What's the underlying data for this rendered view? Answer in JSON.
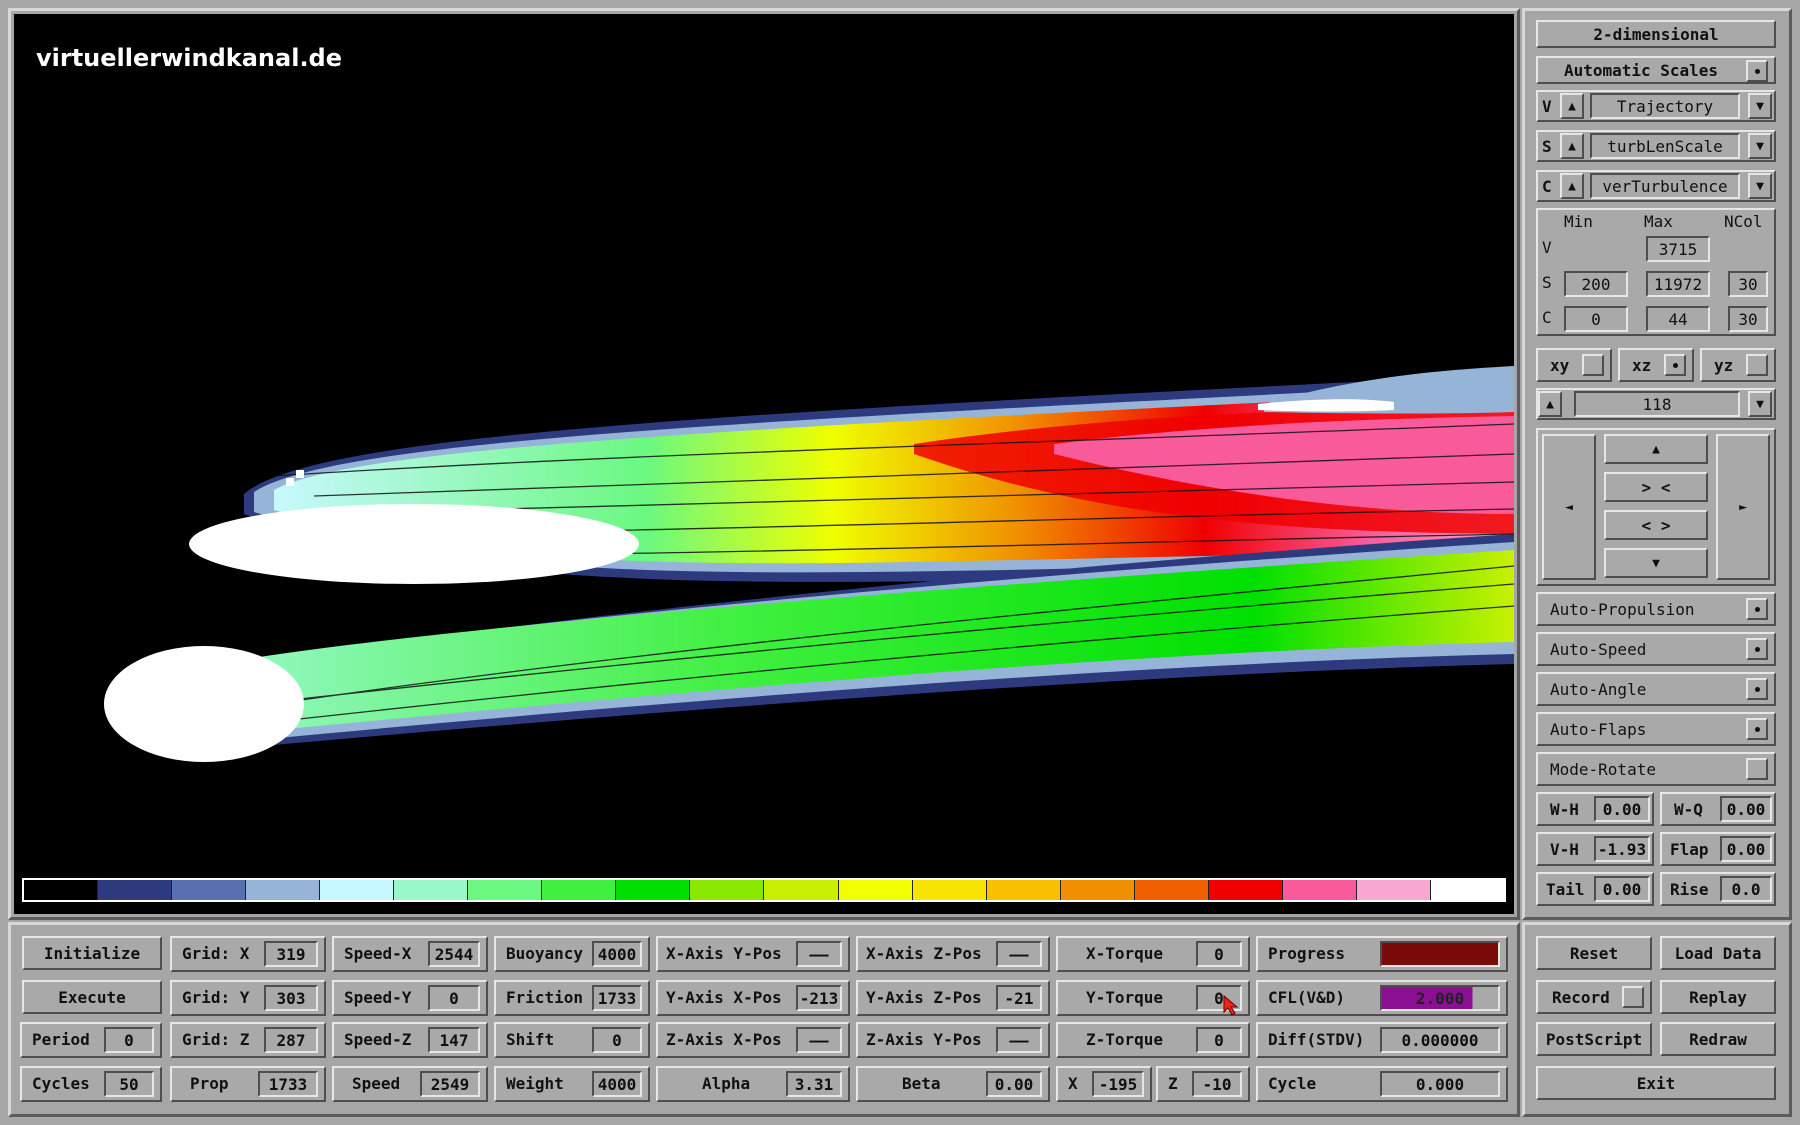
{
  "watermark": "virtuellerwindkanal.de",
  "colors": {
    "background": "#a6a6a6",
    "canvas": "#000000",
    "progress_fill": "#7a0a0a",
    "cfl_fill": "#8a0f93",
    "cursor": "#e8261a",
    "colorbar": [
      "#000000",
      "#2e3a7e",
      "#5a6fb0",
      "#96b4d8",
      "#c8f8ff",
      "#98f8c8",
      "#6af880",
      "#40f040",
      "#00e000",
      "#8ae800",
      "#c8f000",
      "#f0ff00",
      "#f8e400",
      "#f8c000",
      "#f09000",
      "#f06000",
      "#f00000",
      "#f85a9a",
      "#f8a8d0",
      "#ffffff"
    ]
  },
  "right_panel": {
    "mode_label": "2-dimensional",
    "auto_scales_label": "Automatic Scales",
    "v": {
      "letter": "V",
      "value": "Trajectory"
    },
    "s": {
      "letter": "S",
      "value": "turbLenScale"
    },
    "c": {
      "letter": "C",
      "value": "verTurbulence"
    },
    "scale_headers": {
      "min": "Min",
      "max": "Max",
      "ncol": "NCol"
    },
    "scale_rows": {
      "v": {
        "letter": "V",
        "max": "3715"
      },
      "s": {
        "letter": "S",
        "min": "200",
        "max": "11972",
        "ncol": "30"
      },
      "c": {
        "letter": "C",
        "min": "0",
        "max": "44",
        "ncol": "30"
      }
    },
    "planes": {
      "xy": "xy",
      "xz": "xz",
      "yz": "yz"
    },
    "slice_value": "118",
    "nav": {
      "up": "▲",
      "down": "▼",
      "left": "◄",
      "right": "►",
      "zoom_in": "> <",
      "zoom_out": "< >"
    },
    "toggles": {
      "auto_propulsion": "Auto-Propulsion",
      "auto_speed": "Auto-Speed",
      "auto_angle": "Auto-Angle",
      "auto_flaps": "Auto-Flaps",
      "mode_rotate": "Mode-Rotate"
    },
    "params": {
      "wh": {
        "label": "W-H",
        "value": "0.00"
      },
      "wq": {
        "label": "W-Q",
        "value": "0.00"
      },
      "vh": {
        "label": "V-H",
        "value": "-1.93"
      },
      "flap": {
        "label": "Flap",
        "value": "0.00"
      },
      "tail": {
        "label": "Tail",
        "value": "0.00"
      },
      "rise": {
        "label": "Rise",
        "value": "0.0"
      }
    }
  },
  "bottom_panel": {
    "col1": {
      "initialize": "Initialize",
      "execute": "Execute",
      "period": {
        "label": "Period",
        "value": "0"
      },
      "cycles": {
        "label": "Cycles",
        "value": "50"
      }
    },
    "col2": {
      "grid_x": {
        "label": "Grid: X",
        "value": "319"
      },
      "grid_y": {
        "label": "Grid: Y",
        "value": "303"
      },
      "grid_z": {
        "label": "Grid: Z",
        "value": "287"
      },
      "prop": {
        "label": "Prop",
        "value": "1733"
      }
    },
    "col3": {
      "speed_x": {
        "label": "Speed-X",
        "value": "2544"
      },
      "speed_y": {
        "label": "Speed-Y",
        "value": "0"
      },
      "speed_z": {
        "label": "Speed-Z",
        "value": "147"
      },
      "speed": {
        "label": "Speed",
        "value": "2549"
      }
    },
    "col4": {
      "buoyancy": {
        "label": "Buoyancy",
        "value": "4000"
      },
      "friction": {
        "label": "Friction",
        "value": "1733"
      },
      "shift": {
        "label": "Shift",
        "value": "0"
      },
      "weight": {
        "label": "Weight",
        "value": "4000"
      }
    },
    "col5": {
      "x_axis_y_pos": {
        "label": "X-Axis Y-Pos",
        "value": "——"
      },
      "y_axis_x_pos": {
        "label": "Y-Axis X-Pos",
        "value": "-213"
      },
      "z_axis_x_pos": {
        "label": "Z-Axis X-Pos",
        "value": "——"
      },
      "alpha": {
        "label": "Alpha",
        "value": "3.31"
      }
    },
    "col6": {
      "x_axis_z_pos": {
        "label": "X-Axis Z-Pos",
        "value": "——"
      },
      "y_axis_z_pos": {
        "label": "Y-Axis Z-Pos",
        "value": "-21"
      },
      "z_axis_y_pos": {
        "label": "Z-Axis Y-Pos",
        "value": "——"
      },
      "beta": {
        "label": "Beta",
        "value": "0.00"
      }
    },
    "col7": {
      "x_torque": {
        "label": "X-Torque",
        "value": "0"
      },
      "y_torque": {
        "label": "Y-Torque",
        "value": "0"
      },
      "z_torque": {
        "label": "Z-Torque",
        "value": "0"
      },
      "x": {
        "label": "X",
        "value": "-195"
      },
      "z": {
        "label": "Z",
        "value": "-10"
      }
    },
    "col8": {
      "progress": {
        "label": "Progress",
        "value": ""
      },
      "cfl": {
        "label": "CFL(V&D)",
        "value": "2.000"
      },
      "diff": {
        "label": "Diff(STDV)",
        "value": "0.000000"
      },
      "cycle": {
        "label": "Cycle",
        "value": "0.000"
      }
    },
    "col9": {
      "reset": "Reset",
      "load_data": "Load Data",
      "record": "Record",
      "replay": "Replay",
      "postscript": "PostScript",
      "redraw": "Redraw",
      "exit": "Exit"
    }
  }
}
